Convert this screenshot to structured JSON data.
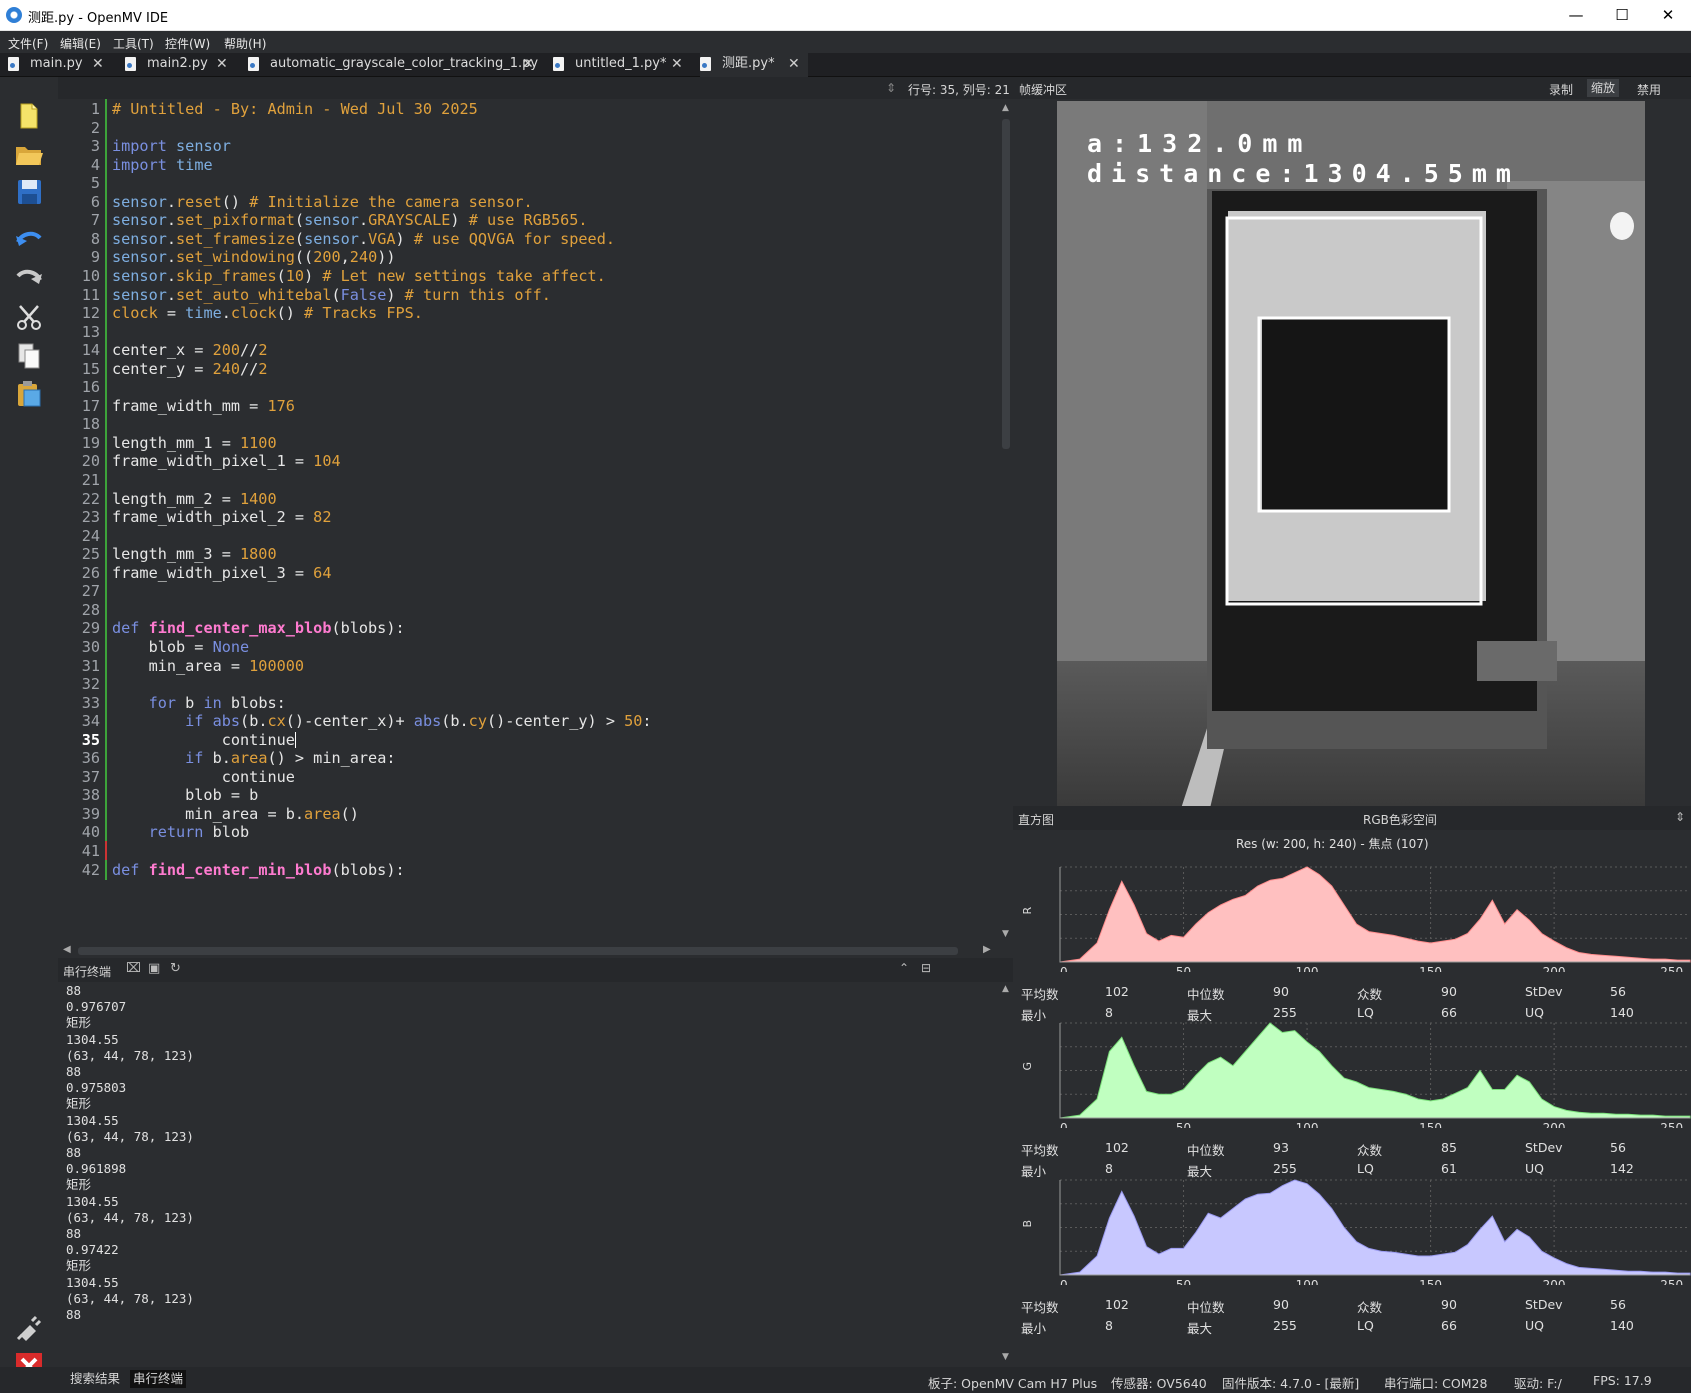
{
  "window": {
    "title": "测距.py - OpenMV IDE",
    "minimize": "—",
    "maximize": "☐",
    "close": "✕"
  },
  "menu": [
    "文件(F)",
    "编辑(E)",
    "工具(T)",
    "控件(W)",
    "帮助(H)"
  ],
  "tabs": [
    {
      "label": "main.py"
    },
    {
      "label": "main2.py"
    },
    {
      "label": "automatic_grayscale_color_tracking_1.py"
    },
    {
      "label": "untitled_1.py*"
    },
    {
      "label": "测距.py*"
    }
  ],
  "tab_close": "✕",
  "toolbar_icons": [
    "new-file-icon",
    "open-folder-icon",
    "save-icon",
    "undo-icon",
    "redo-icon",
    "cut-icon",
    "copy-icon",
    "paste-icon"
  ],
  "editor": {
    "cursor_position": "行号: 35, 列号: 21",
    "current_line": 35,
    "lines": [
      "# Untitled - By: Admin - Wed Jul 30 2025",
      "",
      "import sensor",
      "import time",
      "",
      "sensor.reset() # Initialize the camera sensor.",
      "sensor.set_pixformat(sensor.GRAYSCALE) # use RGB565.",
      "sensor.set_framesize(sensor.VGA) # use QQVGA for speed.",
      "sensor.set_windowing((200,240))",
      "sensor.skip_frames(10) # Let new settings take affect.",
      "sensor.set_auto_whitebal(False) # turn this off.",
      "clock = time.clock() # Tracks FPS.",
      "",
      "center_x = 200//2",
      "center_y = 240//2",
      "",
      "frame_width_mm = 176",
      "",
      "length_mm_1 = 1100",
      "frame_width_pixel_1 = 104",
      "",
      "length_mm_2 = 1400",
      "frame_width_pixel_2 = 82",
      "",
      "length_mm_3 = 1800",
      "frame_width_pixel_3 = 64",
      "",
      "",
      "def find_center_max_blob(blobs):",
      "    blob = None",
      "    min_area = 100000",
      "",
      "    for b in blobs:",
      "        if abs(b.cx()-center_x)+ abs(b.cy()-center_y) > 50:",
      "            continue",
      "        if b.area() > min_area:",
      "            continue",
      "        blob = b",
      "        min_area = b.area()",
      "    return blob",
      "",
      "def find_center_min_blob(blobs):"
    ]
  },
  "terminal": {
    "title": "串行终端",
    "lines": [
      "88",
      "0.976707",
      "矩形",
      "1304.55",
      "(63, 44, 78, 123)",
      "88",
      "0.975803",
      "矩形",
      "1304.55",
      "(63, 44, 78, 123)",
      "88",
      "0.961898",
      "矩形",
      "1304.55",
      "(63, 44, 78, 123)",
      "88",
      "0.97422",
      "矩形",
      "1304.55",
      "(63, 44, 78, 123)",
      "88"
    ]
  },
  "framebuffer": {
    "title": "帧缓冲区",
    "record": "录制",
    "zoom": "缩放",
    "disable": "禁用",
    "overlay_line1": "a:132.0mm",
    "overlay_line2": "distance:1304.55mm"
  },
  "histogram": {
    "title": "直方图",
    "colorspace": "RGB色彩空间",
    "res_label": "Res  (w: 200,  h: 240)  - 焦点  (107)",
    "ticks": [
      "0",
      "50",
      "100",
      "150",
      "200",
      "250"
    ],
    "channels": [
      {
        "axis": "R",
        "color": "#ffc0c0",
        "stroke": "#ff8c8c",
        "stats": {
          "mean_label": "平均数",
          "mean": "102",
          "median_label": "中位数",
          "median": "90",
          "mode_label": "众数",
          "mode": "90",
          "stdev_label": "StDev",
          "stdev": "56",
          "min_label": "最小",
          "min": "8",
          "max_label": "最大",
          "max": "255",
          "lq_label": "LQ",
          "lq": "66",
          "uq_label": "UQ",
          "uq": "140"
        }
      },
      {
        "axis": "G",
        "color": "#c0ffc0",
        "stroke": "#7be07b",
        "stats": {
          "mean_label": "平均数",
          "mean": "102",
          "median_label": "中位数",
          "median": "93",
          "mode_label": "众数",
          "mode": "85",
          "stdev_label": "StDev",
          "stdev": "56",
          "min_label": "最小",
          "min": "8",
          "max_label": "最大",
          "max": "255",
          "lq_label": "LQ",
          "lq": "61",
          "uq_label": "UQ",
          "uq": "142"
        }
      },
      {
        "axis": "B",
        "color": "#c8c8ff",
        "stroke": "#9a9af0",
        "stats": {
          "mean_label": "平均数",
          "mean": "102",
          "median_label": "中位数",
          "median": "90",
          "mode_label": "众数",
          "mode": "90",
          "stdev_label": "StDev",
          "stdev": "56",
          "min_label": "最小",
          "min": "8",
          "max_label": "最大",
          "max": "255",
          "lq_label": "LQ",
          "lq": "66",
          "uq_label": "UQ",
          "uq": "140"
        }
      }
    ]
  },
  "chart_data": {
    "type": "area",
    "x": [
      0,
      8,
      15,
      20,
      25,
      30,
      35,
      40,
      45,
      50,
      55,
      60,
      65,
      70,
      75,
      80,
      85,
      90,
      95,
      100,
      105,
      110,
      115,
      120,
      125,
      130,
      135,
      140,
      145,
      150,
      155,
      160,
      165,
      170,
      175,
      180,
      185,
      190,
      195,
      200,
      205,
      210,
      215,
      220,
      225,
      230,
      235,
      240,
      245,
      250,
      255
    ],
    "series": [
      {
        "values": [
          0,
          3,
          20,
          55,
          85,
          60,
          30,
          22,
          28,
          26,
          40,
          52,
          60,
          66,
          70,
          80,
          86,
          88,
          94,
          100,
          92,
          80,
          60,
          40,
          32,
          30,
          28,
          25,
          22,
          20,
          22,
          24,
          30,
          45,
          65,
          40,
          55,
          44,
          30,
          22,
          15,
          10,
          8,
          7,
          6,
          5,
          4,
          3,
          3,
          2,
          2
        ]
      },
      {
        "values": [
          0,
          3,
          20,
          70,
          85,
          55,
          28,
          25,
          25,
          30,
          45,
          58,
          64,
          55,
          70,
          85,
          100,
          90,
          92,
          80,
          70,
          55,
          42,
          38,
          32,
          30,
          28,
          25,
          20,
          18,
          20,
          26,
          32,
          50,
          30,
          30,
          45,
          38,
          20,
          12,
          8,
          6,
          5,
          5,
          4,
          4,
          3,
          3,
          2,
          2,
          2
        ]
      },
      {
        "values": [
          0,
          3,
          20,
          60,
          88,
          62,
          30,
          22,
          28,
          28,
          45,
          65,
          60,
          70,
          80,
          85,
          86,
          94,
          100,
          96,
          85,
          70,
          50,
          35,
          28,
          25,
          24,
          22,
          20,
          20,
          22,
          24,
          32,
          48,
          62,
          35,
          48,
          40,
          25,
          18,
          12,
          8,
          7,
          6,
          5,
          4,
          4,
          3,
          3,
          2,
          2
        ]
      }
    ],
    "xlim": [
      0,
      255
    ],
    "ylim": [
      0,
      100
    ]
  },
  "statusbar": {
    "search_results": "搜索结果",
    "serial_terminal": "串行终端",
    "board": "板子: OpenMV Cam H7 Plus",
    "sensor": "传感器: OV5640",
    "firmware": "固件版本: 4.7.0 - [最新]",
    "port": "串行端口: COM28",
    "drive": "驱动: F:/",
    "fps": "FPS:  17.9"
  }
}
